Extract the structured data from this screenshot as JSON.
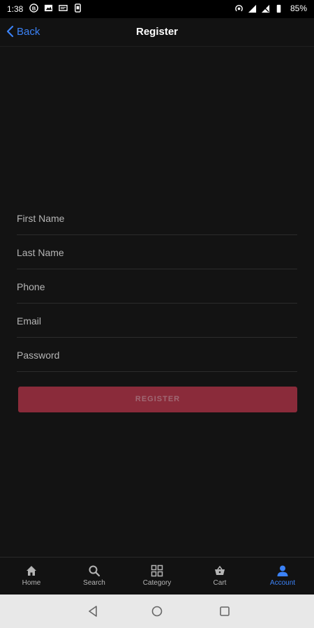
{
  "status_bar": {
    "time": "1:38",
    "battery": "85%"
  },
  "header": {
    "back_label": "Back",
    "title": "Register"
  },
  "form": {
    "fields": [
      {
        "placeholder": "First Name",
        "value": ""
      },
      {
        "placeholder": "Last Name",
        "value": ""
      },
      {
        "placeholder": "Phone",
        "value": ""
      },
      {
        "placeholder": "Email",
        "value": ""
      },
      {
        "placeholder": "Password",
        "value": ""
      }
    ],
    "submit_label": "REGISTER"
  },
  "bottom_nav": {
    "items": [
      {
        "label": "Home",
        "icon": "home-icon"
      },
      {
        "label": "Search",
        "icon": "search-icon"
      },
      {
        "label": "Category",
        "icon": "grid-icon"
      },
      {
        "label": "Cart",
        "icon": "basket-icon"
      },
      {
        "label": "Account",
        "icon": "person-icon",
        "active": true
      }
    ]
  },
  "colors": {
    "background": "#131313",
    "accent": "#3b82f6",
    "register_button": "#8a2b3a",
    "system_nav": "#e8e8e8"
  }
}
